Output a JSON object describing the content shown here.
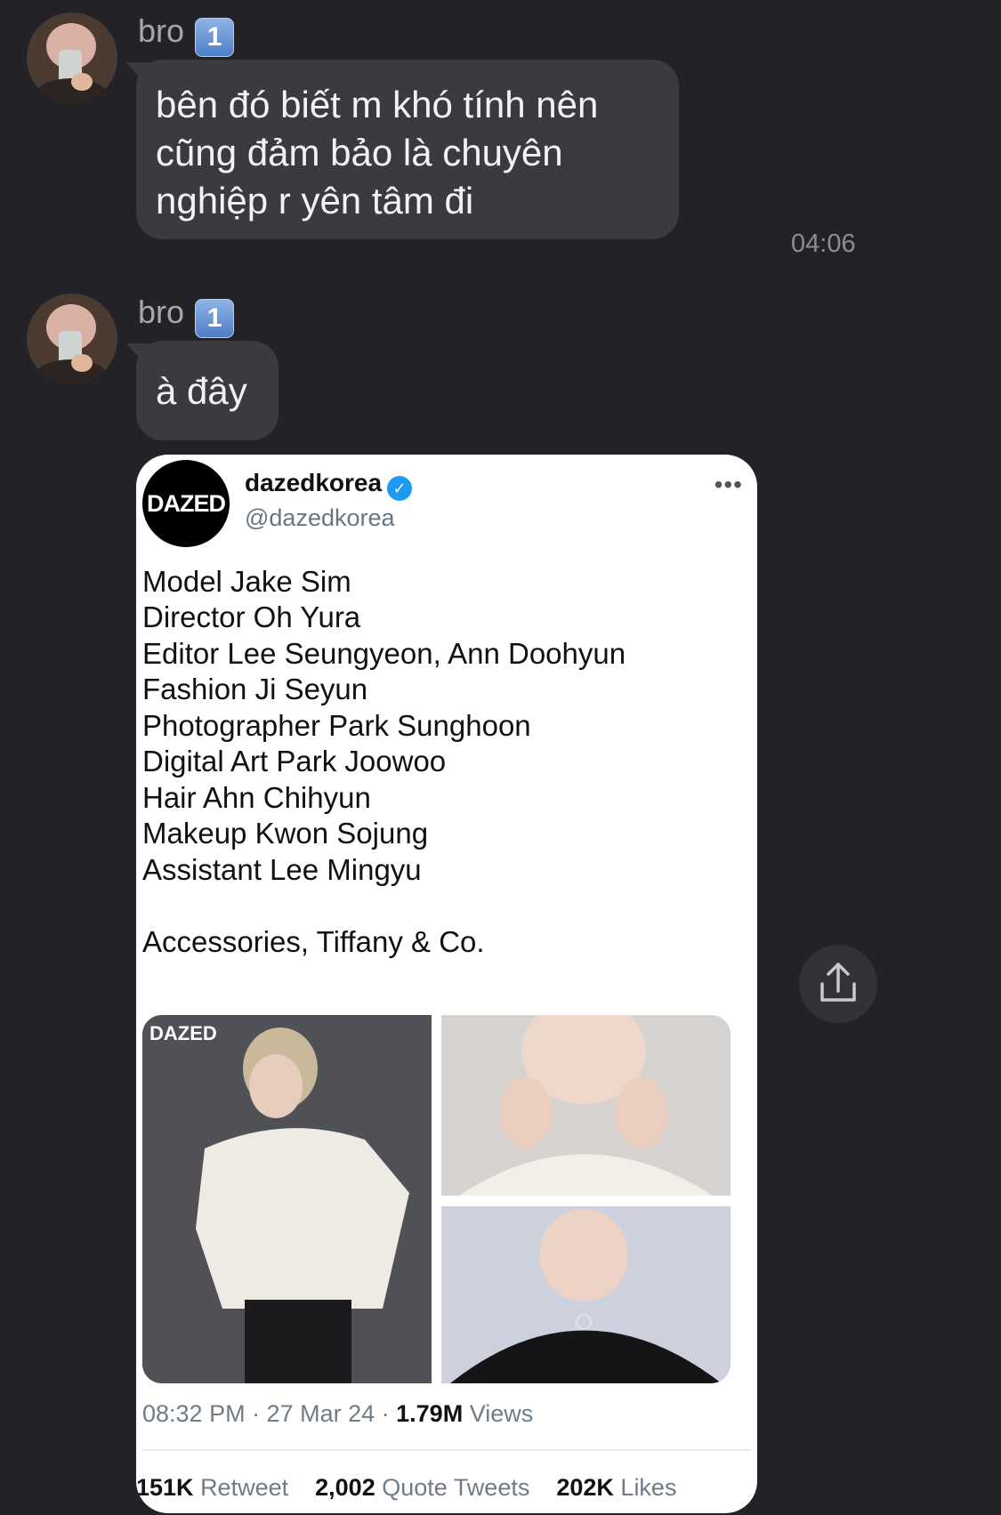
{
  "messages": [
    {
      "sender": "bro",
      "badge": "1",
      "text": "bên đó biết m khó tính nên cũng đảm bảo là chuyên nghiệp r yên tâm đi",
      "time": "04:06"
    },
    {
      "sender": "bro",
      "badge": "1",
      "text": "à đây"
    }
  ],
  "tweet": {
    "logo_text": "DAZED",
    "display_name": "dazedkorea",
    "handle": "@dazedkorea",
    "more": "•••",
    "lines": [
      "Model Jake Sim",
      "Director Oh Yura",
      "Editor Lee Seungyeon, Ann Doohyun",
      "Fashion Ji Seyun",
      "Photographer Park Sunghoon",
      "Digital Art Park Joowoo",
      "Hair Ahn Chihyun",
      "Makeup Kwon Sojung",
      "Assistant Lee Mingyu",
      "Accessories, Tiffany & Co."
    ],
    "image_tag": "DAZED",
    "meta_time": "08:32 PM · 27 Mar 24 ·",
    "views_count": "1.79M",
    "views_label": "Views",
    "retweets_count": "151K",
    "retweets_label": "Retweet",
    "quotes_count": "2,002",
    "quotes_label": "Quote Tweets",
    "likes_count": "202K",
    "likes_label": "Likes"
  },
  "colors": {
    "background": "#232327",
    "bubble": "#3b3b3f",
    "verified": "#1d9bf0"
  },
  "icons": {
    "share": "share-icon",
    "verified": "verified-badge-icon"
  }
}
